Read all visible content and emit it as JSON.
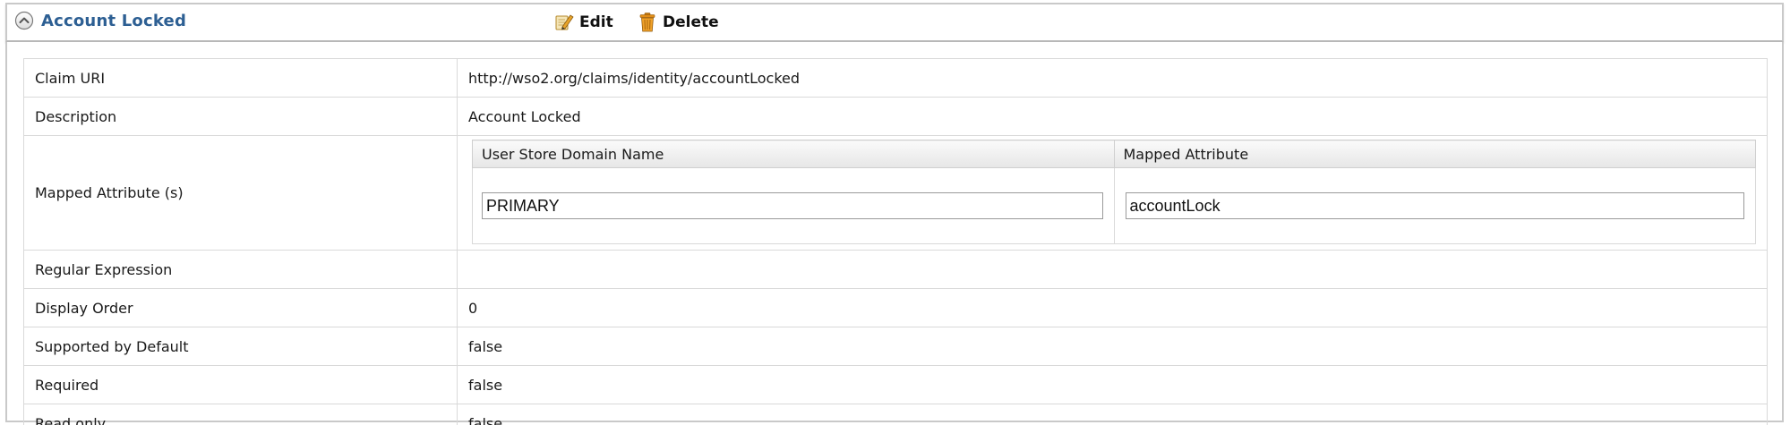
{
  "header": {
    "title": "Account Locked",
    "collapse_icon": "chevron-up-circle-icon",
    "actions": {
      "edit_label": "Edit",
      "edit_icon": "pencil-note-icon",
      "delete_label": "Delete",
      "delete_icon": "trash-can-icon"
    }
  },
  "colors": {
    "title": "#2d5f93",
    "border": "#c9c9c9",
    "grid": "#d9d9d9"
  },
  "properties": {
    "claim_uri": {
      "label": "Claim URI",
      "value": "http://wso2.org/claims/identity/accountLocked"
    },
    "description": {
      "label": "Description",
      "value": "Account Locked"
    },
    "mapped_attributes": {
      "label": "Mapped Attribute (s)",
      "columns": [
        "User Store Domain Name",
        "Mapped Attribute"
      ],
      "rows": [
        {
          "domain": "PRIMARY",
          "attribute": "accountLock"
        }
      ]
    },
    "regular_expression": {
      "label": "Regular Expression",
      "value": ""
    },
    "display_order": {
      "label": "Display Order",
      "value": "0"
    },
    "supported_by_default": {
      "label": "Supported by Default",
      "value": "false"
    },
    "required": {
      "label": "Required",
      "value": "false"
    },
    "read_only": {
      "label": "Read only",
      "value": "false"
    }
  }
}
